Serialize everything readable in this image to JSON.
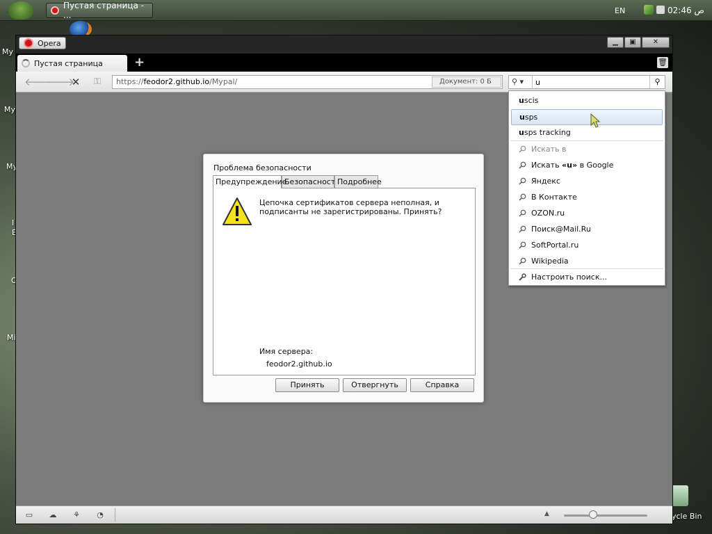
{
  "taskbar": {
    "active_task": "Пустая страница - ...",
    "lang": "EN",
    "clock": "ص 02:46"
  },
  "desktop": {
    "icon_labels": [
      "My",
      "My",
      "My",
      "I",
      "E",
      "O",
      "Mi"
    ],
    "recycle_label": "ycle Bin"
  },
  "browser": {
    "menu_label": "Opera",
    "tab_title": "Пустая страница",
    "new_tab": "+",
    "url_prefix": "https://",
    "url_domain": "feodor2.github.io",
    "url_path": "/Mypal/",
    "doc_indicator": "Документ:   0 Б",
    "search_value": "u",
    "search_engine_icon": "magnifier-icon"
  },
  "dialog": {
    "title": "Проблема безопасности",
    "tabs": [
      "Предупреждение",
      "Безопасность",
      "Подробнее"
    ],
    "message": "Цепочка сертификатов сервера неполная, и подписанты не зарегистрированы. Принять?",
    "server_label": "Имя сервера:",
    "server_value": "feodor2.github.io",
    "buttons": [
      "Принять",
      "Отвергнуть",
      "Справка"
    ]
  },
  "search_dropdown": {
    "suggestions": [
      {
        "bold": "u",
        "rest": "scis"
      },
      {
        "bold": "u",
        "rest": "sps"
      },
      {
        "bold": "u",
        "rest": "sps tracking"
      }
    ],
    "search_in": "Искать в",
    "search_google_pre": "Искать ",
    "search_google_q": "«u»",
    "search_google_post": " в Google",
    "engines": [
      "Яндекс",
      "В Контакте",
      "OZON.ru",
      "Поиск@Mail.Ru",
      "SoftPortal.ru",
      "Wikipedia"
    ],
    "manage": "Настроить поиск..."
  },
  "colors": {
    "content_bg": "#7b7b7b",
    "selection": "#d8e6f6",
    "warning": "#f5e21b"
  }
}
